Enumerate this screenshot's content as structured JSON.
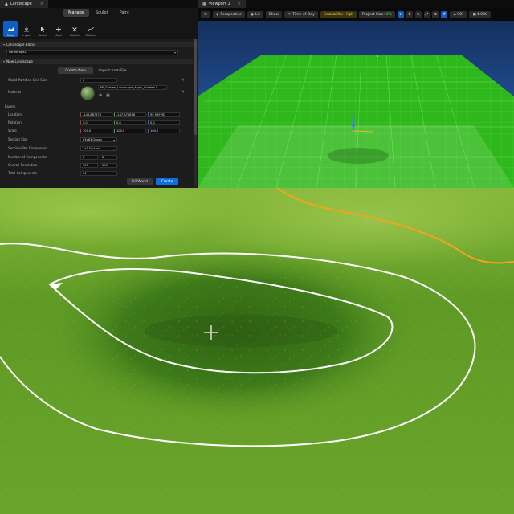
{
  "landscape_panel": {
    "tab_title": "Landscape",
    "modes": [
      "Manage",
      "Sculpt",
      "Paint"
    ],
    "active_mode": "Manage",
    "tools": [
      "New",
      "Import",
      "Select",
      "Add",
      "Delete",
      "Splines"
    ],
    "active_tool": "New",
    "editor_section": "Landscape Editor",
    "landscape_name": "Landscape2",
    "new_section": "New Landscape",
    "create_new": "Create New",
    "import_from_file": "Import from File",
    "grid_size_label": "World Partition Grid Size",
    "grid_size_value": "8",
    "material_label": "Material",
    "material_value": "MI_Graden_Landscape_Apply_Shaded V",
    "layers_label": "Layers",
    "location_label": "Location",
    "location": [
      "-144.887678",
      "-147.876656",
      "99.999762"
    ],
    "rotation_label": "Rotation",
    "rotation": [
      "0.0",
      "0.0",
      "0.0"
    ],
    "scale_label": "Scale",
    "scale": [
      "100.0",
      "100.0",
      "100.0"
    ],
    "section_size_label": "Section Size",
    "section_size_value": "63x63 Quads",
    "sections_per_component_label": "Sections Per Component",
    "sections_per_component_value": "1x1 Section",
    "number_of_components_label": "Number of Components",
    "number_of_components": [
      "8",
      "8"
    ],
    "overall_resolution_label": "Overall Resolution",
    "overall_resolution": [
      "505",
      "505"
    ],
    "total_components_label": "Total Components",
    "total_components_value": "64",
    "fill_world": "Fill World",
    "create": "Create"
  },
  "viewport": {
    "tab_title": "Viewport 1",
    "perspective": "Perspective",
    "lit": "Lit",
    "show": "Show",
    "time_of_day": "Time of Day",
    "scalability": "Scalability: High",
    "project_size": "Project Size:",
    "project_size_value": "0%",
    "fov": "90°",
    "camera_speed": "4.000",
    "colors": {
      "sky": "#1d4f94",
      "terrain": "#2fbe1e",
      "toolbar": "#0a0a0a"
    }
  },
  "terrain_view": {
    "colors": {
      "grass": "#5f9b23",
      "outline": "#ffffff",
      "spline": "#f2a51c"
    }
  }
}
